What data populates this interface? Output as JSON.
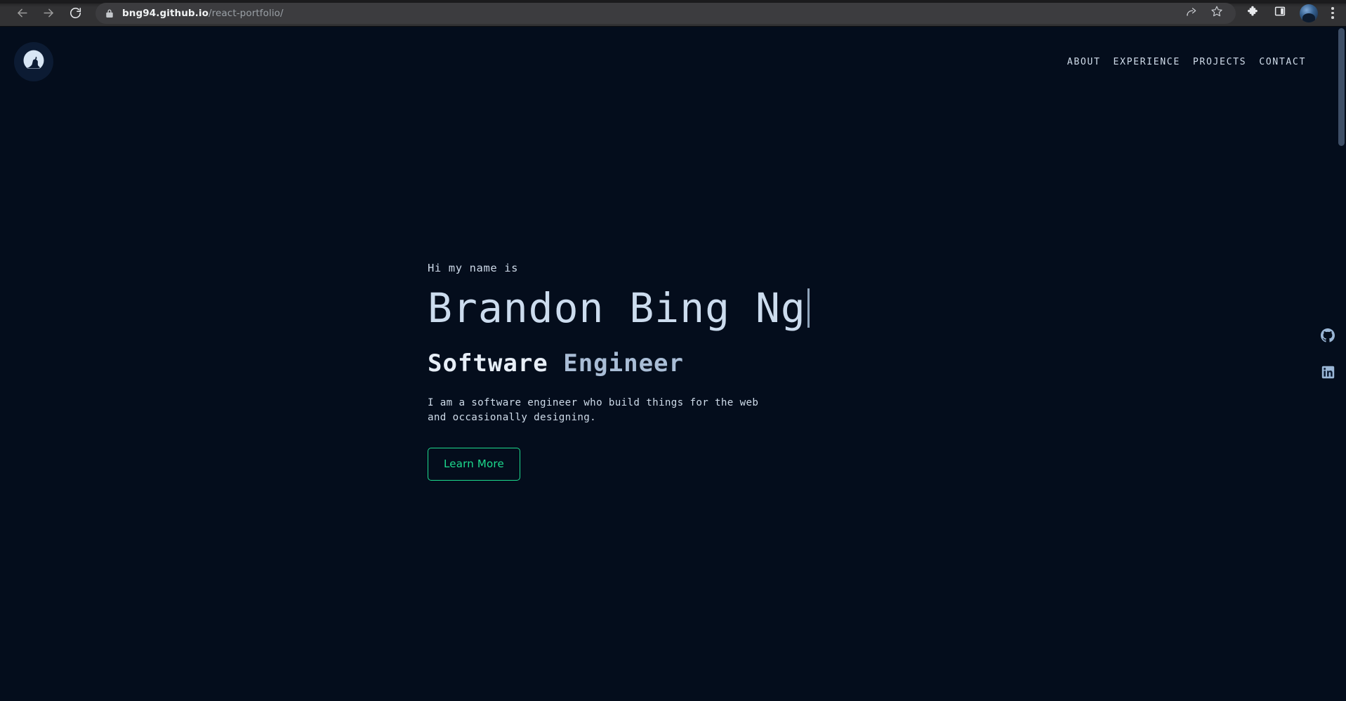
{
  "browser": {
    "back_icon": "arrow-left-icon",
    "forward_icon": "arrow-right-icon",
    "reload_icon": "reload-icon",
    "lock_icon": "lock-icon",
    "url_host": "bng94.github.io",
    "url_path": "/react-portfolio/",
    "share_icon": "share-icon",
    "bookmark_icon": "star-icon",
    "extensions_icon": "puzzle-piece-icon",
    "side_panel_icon": "side-panel-icon",
    "profile_icon": "profile-avatar",
    "menu_icon": "kebab-menu-icon"
  },
  "site": {
    "logo_name": "wolf-howling-moon-logo",
    "nav": [
      {
        "label": "ABOUT"
      },
      {
        "label": "EXPERIENCE"
      },
      {
        "label": "PROJECTS"
      },
      {
        "label": "CONTACT"
      }
    ]
  },
  "hero": {
    "greeting": "Hi my name is",
    "name": "Brandon Bing Ng",
    "role_first": "Software",
    "role_second": " Engineer",
    "description": "I am a software engineer who build things for the web and occasionally designing.",
    "cta_label": "Learn More"
  },
  "socials": [
    {
      "name": "github",
      "icon": "github-icon"
    },
    {
      "name": "linkedin",
      "icon": "linkedin-icon"
    }
  ],
  "colors": {
    "page_background": "#040d1c",
    "accent_green": "#1ddb8e",
    "heading_blue": "#ccdcee",
    "muted_blue": "#a9bdd6",
    "logo_circle": "#0c1b33",
    "scrollbar_thumb": "#3d4e66"
  }
}
